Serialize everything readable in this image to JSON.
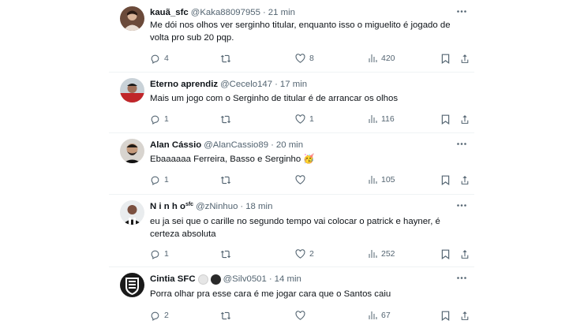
{
  "feed": {
    "tweets": [
      {
        "name": "kauã_sfc",
        "handle": "@Kaka88097955",
        "separator": "·",
        "time": "21 min",
        "text": "Me dói nos olhos ver serginho titular, enquanto isso o miguelito é jogado de volta pro sub 20 pqp.",
        "replies": "4",
        "retweets": "",
        "likes": "8",
        "views": "420"
      },
      {
        "name": "Eterno aprendiz",
        "handle": "@Cecelo147",
        "separator": "·",
        "time": "17 min",
        "text": "Mais um jogo com o Serginho de titular é de arrancar os olhos",
        "replies": "1",
        "retweets": "",
        "likes": "1",
        "views": "116"
      },
      {
        "name": "Alan Cássio",
        "handle": "@AlanCassio89",
        "separator": "·",
        "time": "20 min",
        "text": "Ebaaaaaa Ferreira, Basso e Serginho",
        "emoji": "🥳",
        "replies": "1",
        "retweets": "",
        "likes": "",
        "views": "105"
      },
      {
        "name": "N i n h o",
        "name_suffix": "sfc",
        "handle": "@zNinhuo",
        "separator": "·",
        "time": "18 min",
        "text": "eu ja sei que o carille no segundo tempo vai colocar o patrick e hayner, é certeza absoluta",
        "replies": "1",
        "retweets": "",
        "likes": "2",
        "views": "252"
      },
      {
        "name": "Cintia SFC",
        "handle": "@Silv0501",
        "separator": "·",
        "time": "14 min",
        "text": "Porra olhar pra esse cara é me jogar cara que o Santos caiu",
        "replies": "2",
        "retweets": "",
        "likes": "",
        "views": "67"
      }
    ]
  },
  "colors": {
    "text": "#0f1419",
    "secondary": "#536471",
    "divider": "#eff3f4"
  },
  "icons": [
    "more-icon",
    "reply-icon",
    "retweet-icon",
    "like-icon",
    "views-icon",
    "bookmark-icon",
    "share-icon"
  ]
}
